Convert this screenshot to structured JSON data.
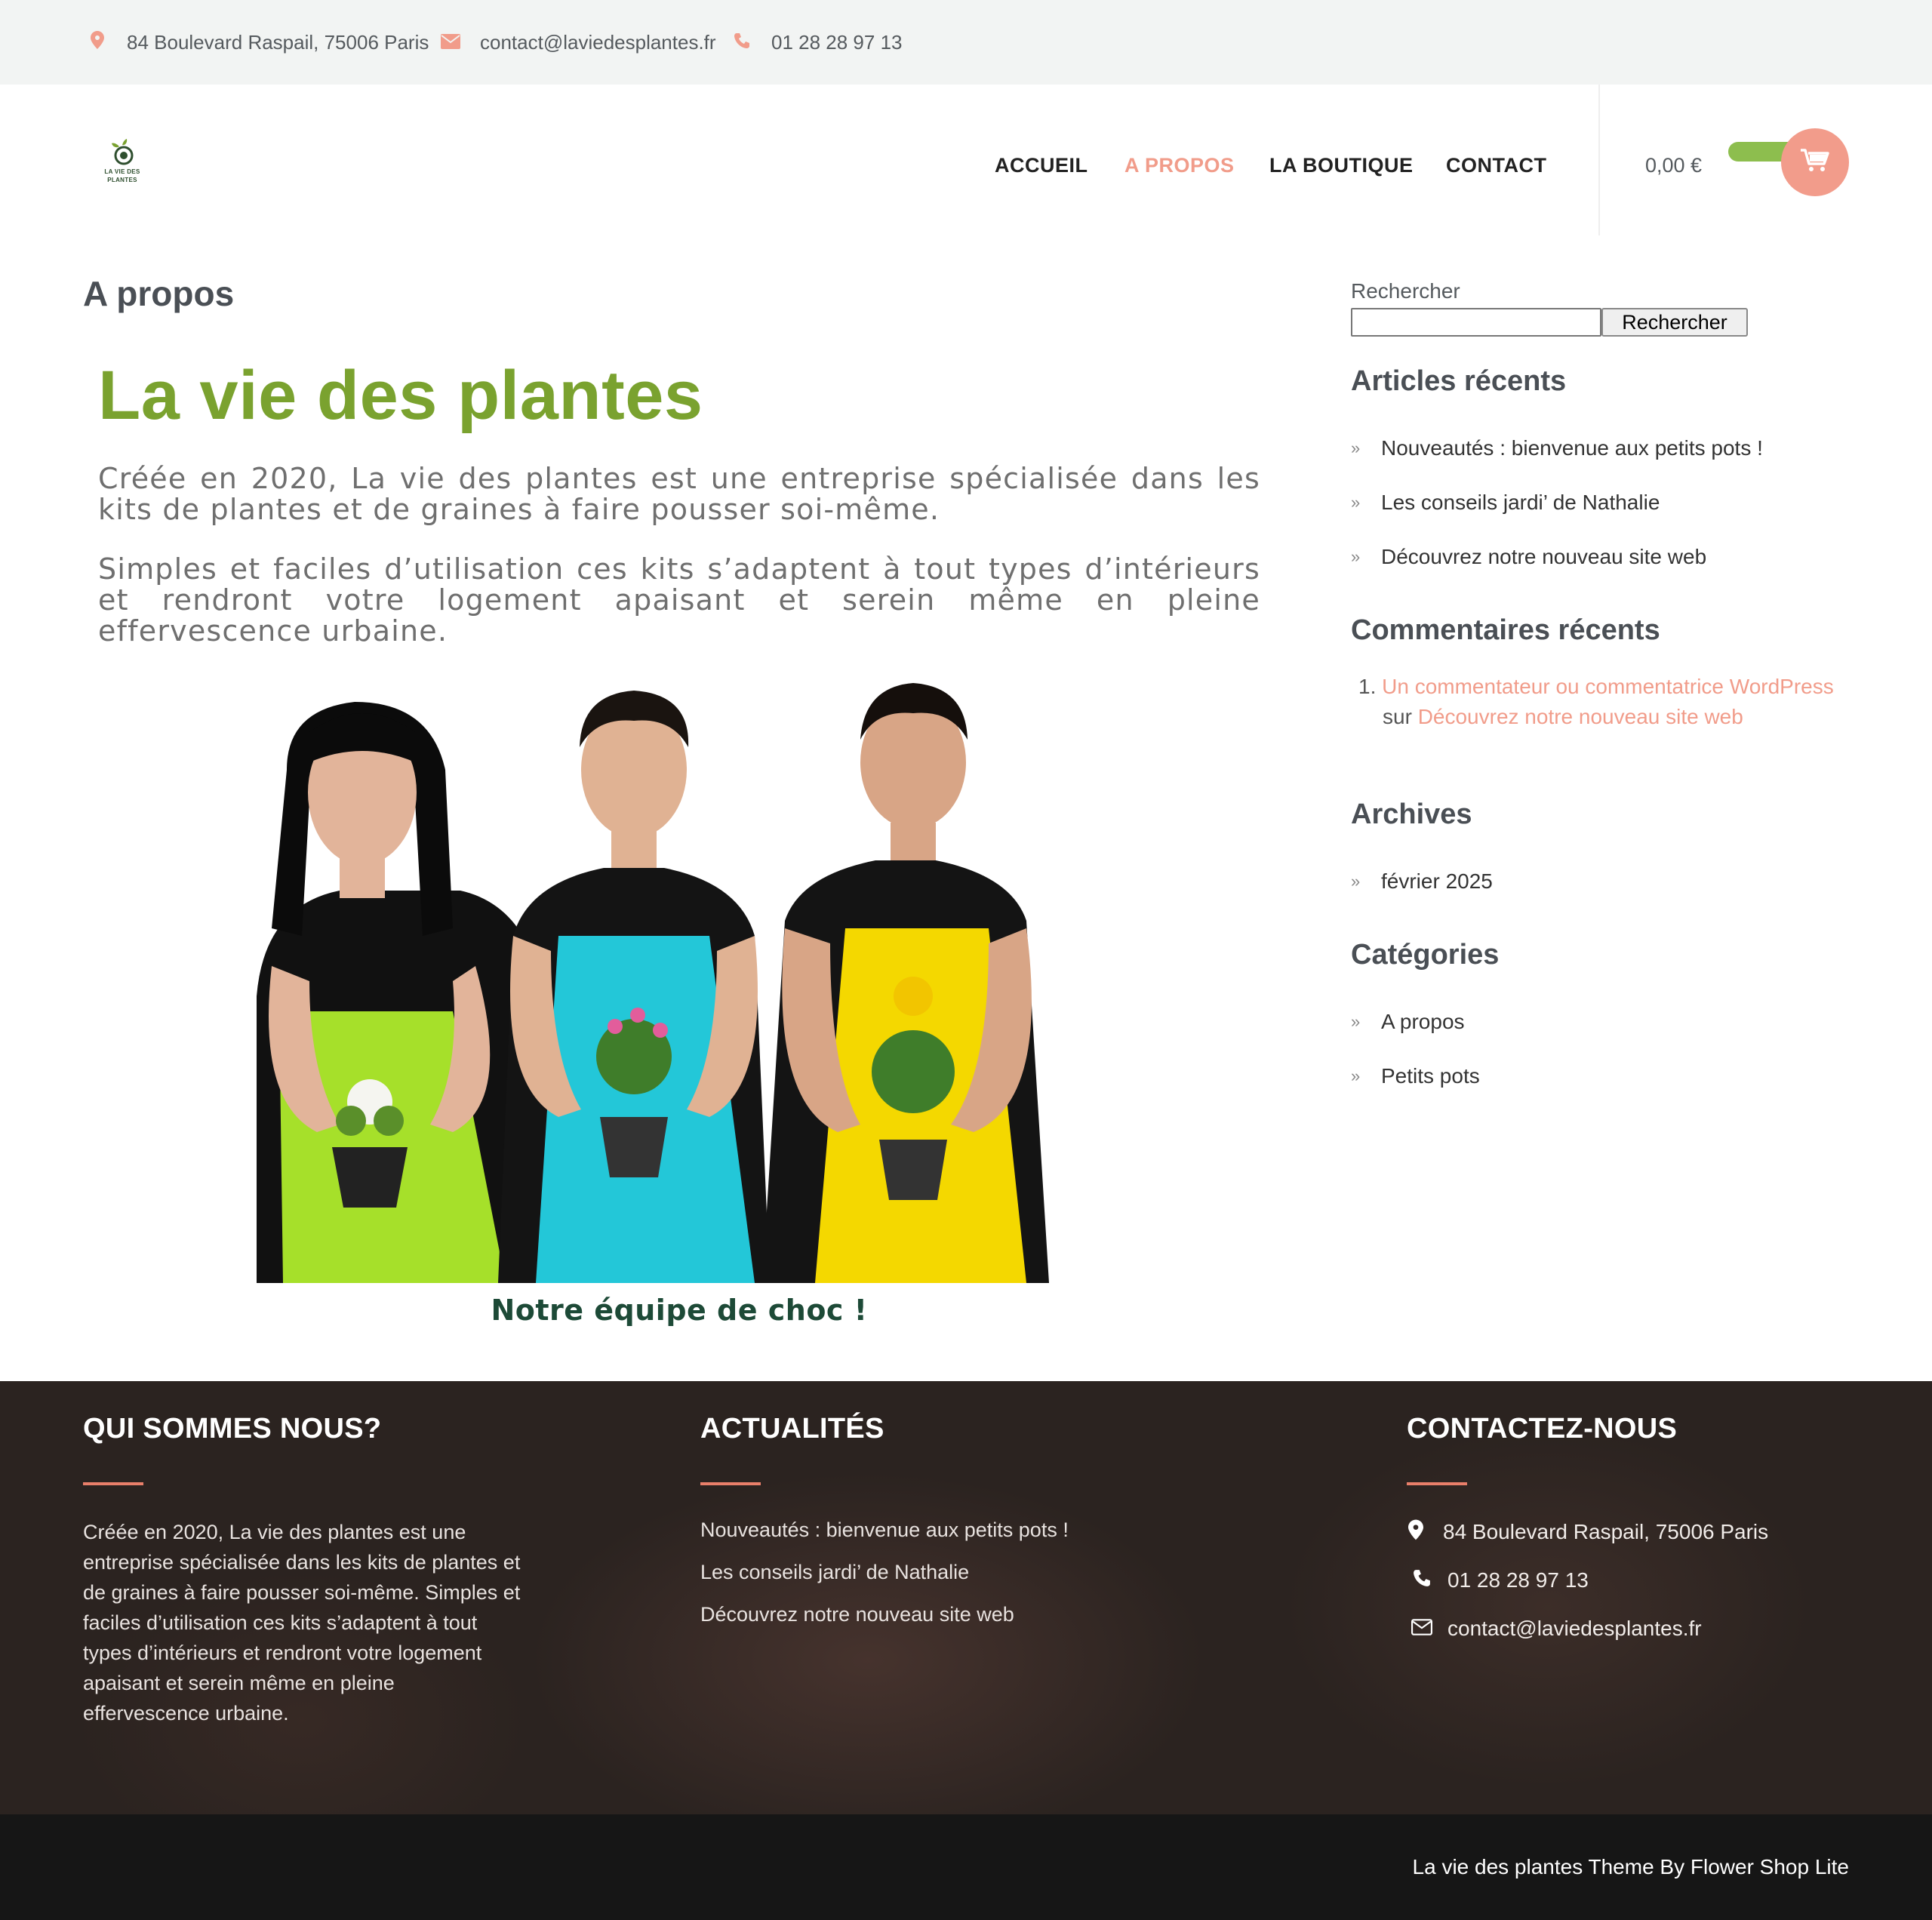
{
  "topbar": {
    "address": "84 Boulevard Raspail, 75006 Paris",
    "email": "contact@laviedesplantes.fr",
    "phone": "01 28 28 97 13",
    "icons": [
      "map-marker-icon",
      "envelope-icon",
      "phone-icon"
    ]
  },
  "header": {
    "logo_text": "LA VIE DES PLANTES",
    "nav": [
      "ACCUEIL",
      "A PROPOS",
      "LA BOUTIQUE",
      "CONTACT"
    ],
    "active_nav": "A PROPOS",
    "cart_total": "0,00 €",
    "cart_icon": "shopping-cart-icon"
  },
  "main": {
    "page_title": "A propos",
    "heading": "La vie des plantes",
    "paragraph1": "Créée en 2020, La vie des plantes est une entreprise spécialisée dans les kits de plantes et de graines à faire pousser soi-même.",
    "paragraph2": "Simples et faciles d’utilisation ces kits s’adaptent à tout types d’intérieurs et rendront votre logement apaisant et serein même en pleine effervescence urbaine.",
    "caption": "Notre équipe de choc !"
  },
  "sidebar": {
    "search_label": "Rechercher",
    "search_value": "",
    "search_button": "Rechercher",
    "recent_posts_title": "Articles récents",
    "recent_posts": [
      "Nouveautés : bienvenue aux petits pots !",
      "Les conseils jardi’ de Nathalie",
      "Découvrez notre nouveau site web"
    ],
    "recent_comments_title": "Commentaires récents",
    "comment": {
      "number": "1.",
      "author": "Un commentateur ou commentatrice WordPress",
      "on": "sur",
      "post": "Découvrez notre nouveau site web"
    },
    "archives_title": "Archives",
    "archives": [
      "février 2025"
    ],
    "categories_title": "Catégories",
    "categories": [
      "A propos",
      "Petits pots"
    ]
  },
  "footer": {
    "about_title": "QUI SOMMES NOUS?",
    "about_text": "Créée en 2020, La vie des plantes est une entreprise spécialisée dans les kits de plantes et de graines à faire pousser soi-même. Simples et faciles d’utilisation ces kits s’adaptent à tout types d’intérieurs et rendront votre logement apaisant et serein même en pleine effervescence urbaine.",
    "news_title": "ACTUALITÉS",
    "news": [
      "Nouveautés : bienvenue aux petits pots !",
      "Les conseils jardi’ de Nathalie",
      "Découvrez notre nouveau site web"
    ],
    "contact_title": "CONTACTEZ-NOUS",
    "contact_address": "84 Boulevard Raspail, 75006 Paris",
    "contact_phone": "01 28 28 97 13",
    "contact_email": "contact@laviedesplantes.fr",
    "credit": "La vie des plantes Theme By Flower Shop Lite"
  },
  "colors": {
    "accent": "#f19c8a",
    "brand_green": "#7aa22f",
    "caption_green": "#1d4a37",
    "footer_bg": "#2b2320",
    "bottombar_bg": "#161616"
  }
}
